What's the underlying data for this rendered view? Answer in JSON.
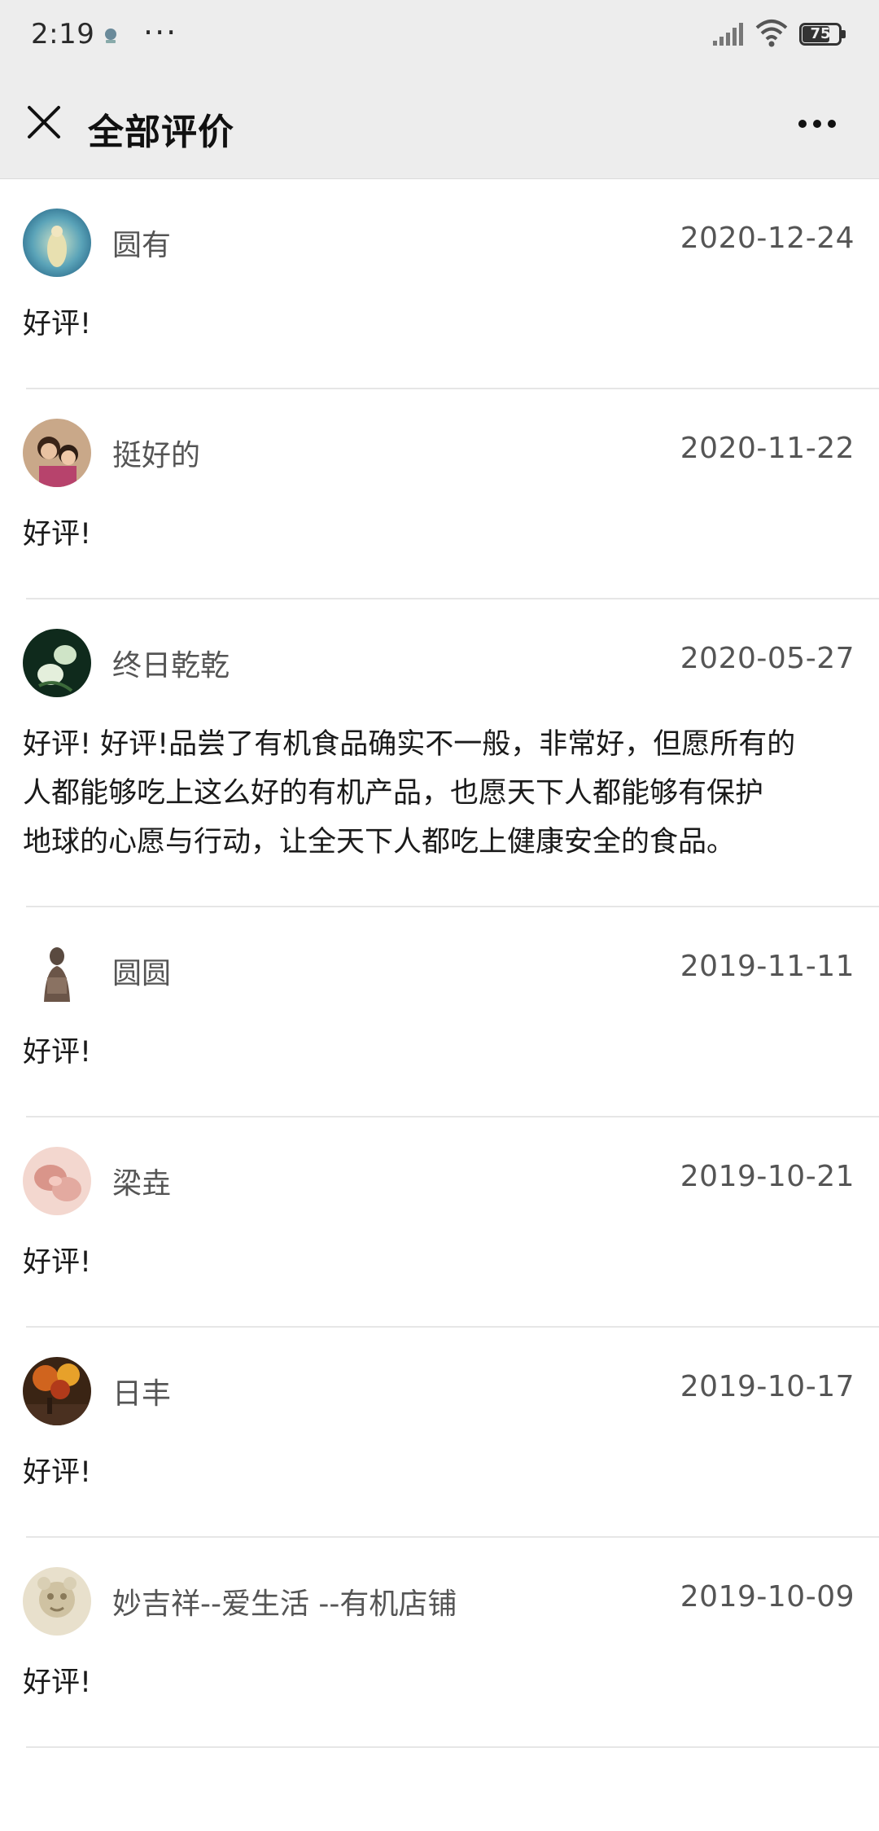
{
  "status_bar": {
    "time": "2:19",
    "dots": "···",
    "battery": "75",
    "battery_level": 0.75
  },
  "nav": {
    "title": "全部评价"
  },
  "reviews": [
    {
      "name": "圆有",
      "date": "2020-12-24",
      "text": "好评!"
    },
    {
      "name": "挺好的",
      "date": "2020-11-22",
      "text": "好评!"
    },
    {
      "name": "终日乾乾",
      "date": "2020-05-27",
      "text": "好评! 好评!品尝了有机食品确实不一般，非常好，但愿所有的\n人都能够吃上这么好的有机产品，也愿天下人都能够有保护\n地球的心愿与行动，让全天下人都吃上健康安全的食品。"
    },
    {
      "name": "圆圆",
      "date": "2019-11-11",
      "text": "好评!"
    },
    {
      "name": "梁垚",
      "date": "2019-10-21",
      "text": "好评!"
    },
    {
      "name": "日丰",
      "date": "2019-10-17",
      "text": "好评!"
    },
    {
      "name": "妙吉祥--爱生活 --有机店铺",
      "date": "2019-10-09",
      "text": "好评!"
    }
  ],
  "colors": {
    "header_bg": "#ededed",
    "text_primary": "#1a1a1a",
    "text_secondary": "#555555",
    "divider": "#e6e6e6"
  },
  "icons": {
    "close": "close-icon",
    "more": "more-icon",
    "signal": "signal-icon",
    "wifi": "wifi-icon",
    "battery": "battery-icon"
  }
}
